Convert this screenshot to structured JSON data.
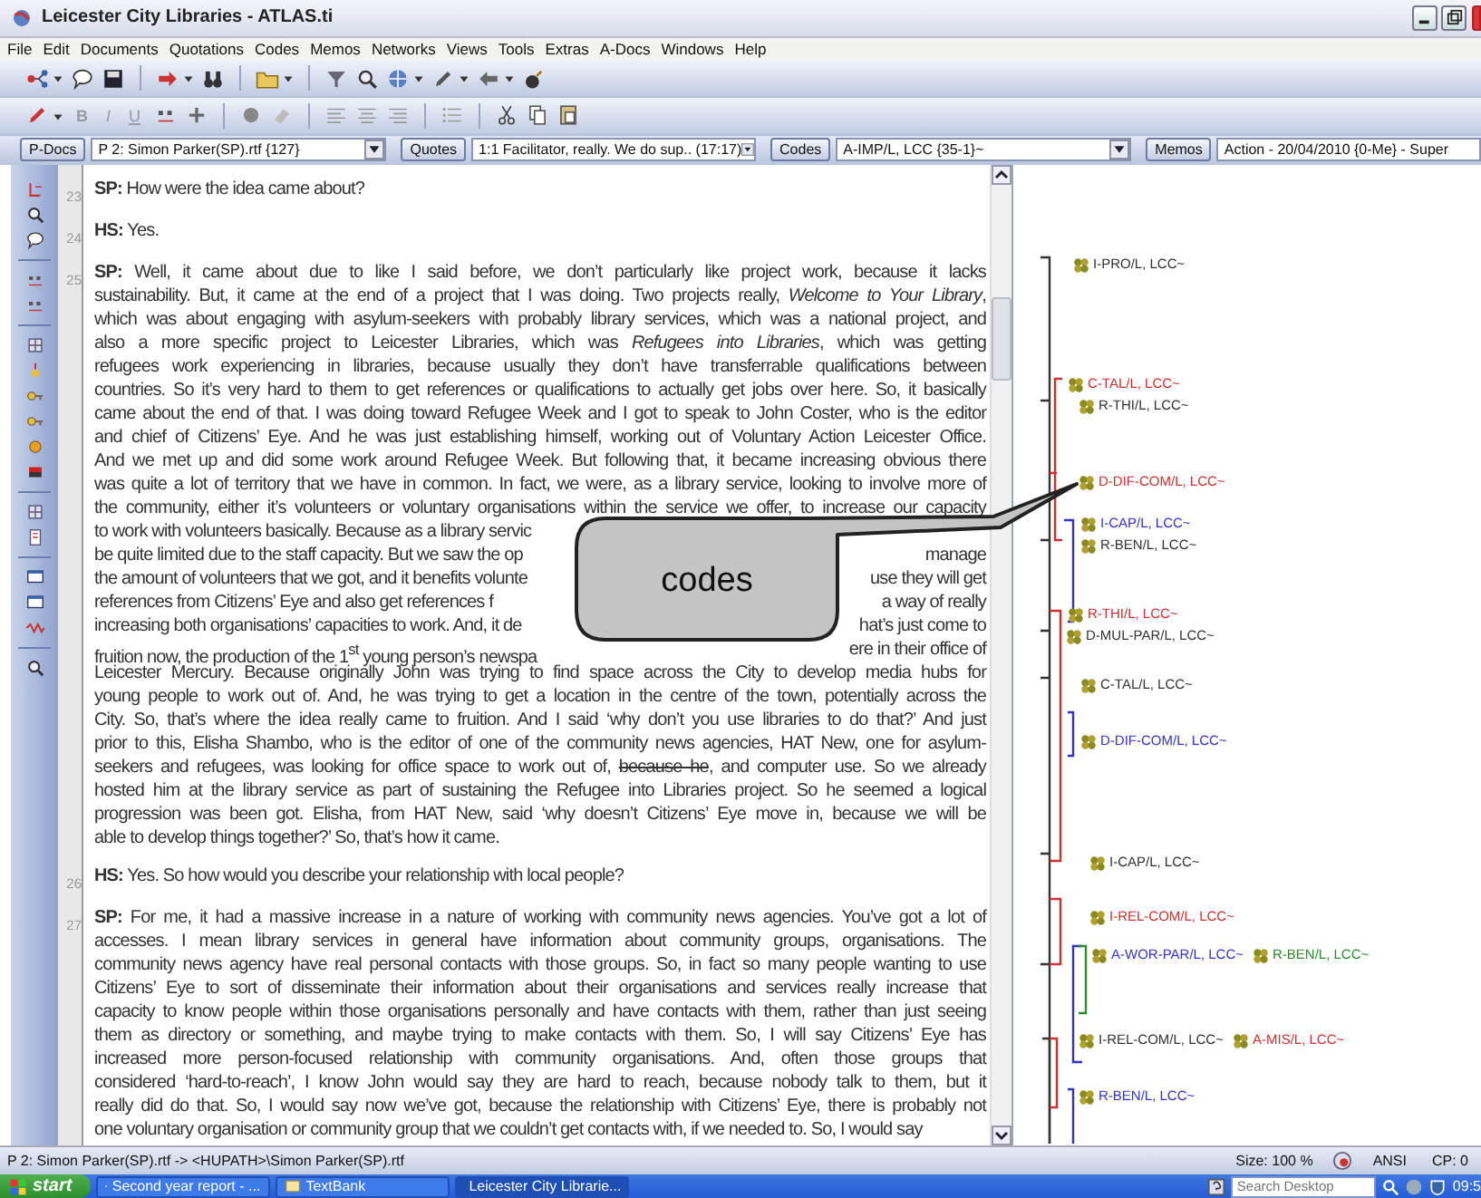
{
  "window": {
    "title": "Leicester City Libraries - ATLAS.ti"
  },
  "menu": [
    "File",
    "Edit",
    "Documents",
    "Quotations",
    "Codes",
    "Memos",
    "Networks",
    "Views",
    "Tools",
    "Extras",
    "A-Docs",
    "Windows",
    "Help"
  ],
  "format_letters": [
    "B",
    "I",
    "U"
  ],
  "selectors": [
    {
      "button": "P-Docs",
      "value": "P 2: Simon Parker(SP).rtf {127}"
    },
    {
      "button": "Quotes",
      "value": "1:1 Facilitator, really. We do sup.. (17:17)"
    },
    {
      "button": "Codes",
      "value": "A-IMP/L, LCC {35-1}~"
    },
    {
      "button": "Memos",
      "value": "Action - 20/04/2010 {0-Me} - Super"
    }
  ],
  "document": {
    "paragraphs": [
      {
        "number": "23",
        "lines": [
          {
            "kind": "text",
            "text": "**SP:** How were the idea came about?"
          }
        ]
      },
      {
        "number": "24",
        "lines": [
          {
            "kind": "text",
            "text": "**HS:** Yes."
          }
        ]
      },
      {
        "number": "25",
        "lines": [
          {
            "kind": "text",
            "text": "**SP:** Well, it came about due to like I said before, we don’t particularly like project work, because it lacks"
          },
          {
            "kind": "text",
            "text": "sustainability. But, it came at the end of a project that I was doing. Two projects really, *Welcome to Your Library*,"
          },
          {
            "kind": "text",
            "text": "which was about engaging with asylum-seekers with probably library services, which was a national project, and"
          },
          {
            "kind": "text",
            "text": "also a more specific project to Leicester Libraries, which was *Refugees into Libraries*, which was getting"
          },
          {
            "kind": "text",
            "text": "refugees work experiencing in libraries, because usually they don’t have transferrable qualifications between"
          },
          {
            "kind": "text",
            "text": "countries. So it’s very hard to them to get references or qualifications to actually get jobs over here. So, it basically"
          },
          {
            "kind": "text",
            "text": "came about the end of that. I was doing toward Refugee Week and I got to speak to John Coster, who is the editor"
          },
          {
            "kind": "text",
            "text": "and chief of Citizens’ Eye. And he was just establishing himself, working out of Voluntary Action Leicester Office."
          },
          {
            "kind": "text",
            "text": "And we met up and did some work around Refugee Week. But following that, it became increasing obvious there"
          },
          {
            "kind": "text",
            "text": "was quite a lot of territory that we have in common. In fact, we were, as a library service, looking to involve more of"
          },
          {
            "kind": "text",
            "text": "the community, either it’s volunteers or voluntary organisations within the service we offer, to increase our capacity"
          },
          {
            "kind": "split",
            "left": "to work with volunteers basically. Because as a library servic"
          },
          {
            "kind": "split",
            "left": "be quite limited due to the staff capacity. But we saw the op",
            "right": "manage"
          },
          {
            "kind": "split",
            "left": "the amount of volunteers that we got, and it benefits volunte",
            "right": "use they will get"
          },
          {
            "kind": "split",
            "left": "references from Citizens’ Eye and also get references f",
            "right": "a way of really"
          },
          {
            "kind": "split",
            "left": "increasing both organisations’ capacities to work. And, it de",
            "right": "hat’s just come to"
          },
          {
            "kind": "split",
            "left": "fruition now, the production of the 1$^{st}$ young person’s newspa",
            "right": "ere in their office of"
          },
          {
            "kind": "text",
            "text": "Leicester Mercury. Because originally John was trying to find space across the City to develop media hubs for"
          },
          {
            "kind": "text",
            "text": "young people to work out of. And, he was trying to get a location in the centre of the town, potentially across the"
          },
          {
            "kind": "text",
            "text": "City. So, that’s where the idea really came to fruition. And I said ‘why don’t you use libraries to do that?’ And just"
          },
          {
            "kind": "text",
            "text": "prior to this, Elisha Shambo, who is the editor of one of the community news agencies, HAT New, one for asylum-"
          },
          {
            "kind": "struck",
            "segments": [
              {
                "text": "seekers and refugees, was looking for office space to work out of, ",
                "struck": false
              },
              {
                "text": "because he",
                "struck": true
              },
              {
                "text": ", and computer use. So we already",
                "struck": false
              }
            ]
          },
          {
            "kind": "text",
            "text": "hosted him at the library service as part of sustaining the Refugee into Libraries project. So he seemed a logical"
          },
          {
            "kind": "text",
            "text": "progression was been got. Elisha, from HAT New,  said ‘why doesn’t Citizens’ Eye move in, because we will be"
          },
          {
            "kind": "text",
            "text": "able to develop things together?’ So, that’s how it came."
          }
        ]
      },
      {
        "number": "26",
        "lines": [
          {
            "kind": "text",
            "text": "**HS:** Yes. So how would you describe your relationship with local people?"
          }
        ]
      },
      {
        "number": "27",
        "lines": [
          {
            "kind": "text",
            "text": "**SP:** For me, it had a massive increase in a nature of working with community news agencies. You’ve got a lot of"
          },
          {
            "kind": "text",
            "text": "accesses. I mean library services in general have information about community groups, organisations. The"
          },
          {
            "kind": "text",
            "text": "community news agency have real personal contacts with those groups. So, in fact so many people wanting to use"
          },
          {
            "kind": "text",
            "text": "Citizens’ Eye to sort of disseminate their information about their organisations and services really increase that"
          },
          {
            "kind": "text",
            "text": "capacity to know people within those organisations personally and have contacts with them, rather than just seeing"
          },
          {
            "kind": "text",
            "text": "them as directory or something, and maybe trying to make contacts with them. So, I will say Citizens’ Eye has"
          },
          {
            "kind": "text",
            "text": "increased more person-focused relationship with community organisations. And, often those groups that"
          },
          {
            "kind": "text",
            "text": "considered ‘hard-to-reach’, I know John would say they are hard to reach, because nobody talk to them, but it"
          },
          {
            "kind": "text",
            "text": "really did do that. So, I would say now we’ve got, because the relationship with Citizens’ Eye, there is probably not"
          },
          {
            "kind": "text",
            "text": "one voluntary organisation or community group that we couldn’t get contacts with, if we needed to. So, I would say"
          }
        ]
      }
    ]
  },
  "callout": {
    "text": "codes"
  },
  "margin_codes": [
    {
      "codes": [
        {
          "label": "I-PRO/L, LCC~",
          "color": "#333333"
        }
      ]
    },
    {
      "codes": [
        {
          "label": "C-TAL/L, LCC~",
          "color": "#d03030"
        }
      ]
    },
    {
      "codes": [
        {
          "label": "R-THI/L, LCC~",
          "color": "#333333"
        }
      ]
    },
    {
      "codes": [
        {
          "label": "D-DIF-COM/L, LCC~",
          "color": "#d03030"
        }
      ]
    },
    {
      "codes": [
        {
          "label": "I-CAP/L, LCC~",
          "color": "#3333cc"
        }
      ]
    },
    {
      "codes": [
        {
          "label": "R-BEN/L, LCC~",
          "color": "#333333"
        }
      ]
    },
    {
      "codes": [
        {
          "label": "R-THI/L, LCC~",
          "color": "#d03030"
        }
      ]
    },
    {
      "codes": [
        {
          "label": "D-MUL-PAR/L, LCC~",
          "color": "#333333"
        }
      ]
    },
    {
      "codes": [
        {
          "label": "C-TAL/L, LCC~",
          "color": "#333333"
        }
      ]
    },
    {
      "codes": [
        {
          "label": "D-DIF-COM/L, LCC~",
          "color": "#3333cc"
        }
      ]
    },
    {
      "codes": [
        {
          "label": "I-CAP/L, LCC~",
          "color": "#333333"
        }
      ]
    },
    {
      "codes": [
        {
          "label": "I-REL-COM/L, LCC~",
          "color": "#d03030"
        }
      ]
    },
    {
      "codes": [
        {
          "label": "A-WOR-PAR/L, LCC~",
          "color": "#3333cc"
        },
        {
          "label": "R-BEN/L, LCC~",
          "color": "#2e8b2e"
        }
      ]
    },
    {
      "codes": [
        {
          "label": "I-REL-COM/L, LCC~",
          "color": "#333333"
        },
        {
          "label": "A-MIS/L, LCC~",
          "color": "#d03030"
        }
      ]
    },
    {
      "codes": [
        {
          "label": "R-BEN/L, LCC~",
          "color": "#3333cc"
        }
      ]
    }
  ],
  "status_bar": {
    "path": "P 2: Simon Parker(SP).rtf -> <HUPATH>\\Simon Parker(SP).rtf",
    "size": "Size: 100 %",
    "encoding": "ANSI",
    "code_page": "CP: 0"
  },
  "taskbar": {
    "start": "start",
    "tasks": [
      {
        "label": "Second year report - ...",
        "selected": false
      },
      {
        "label": "TextBank",
        "selected": false
      },
      {
        "label": "Leicester City Librarie...",
        "selected": true
      }
    ],
    "search": {
      "placeholder": "Search Desktop"
    },
    "clock": "09:5"
  }
}
